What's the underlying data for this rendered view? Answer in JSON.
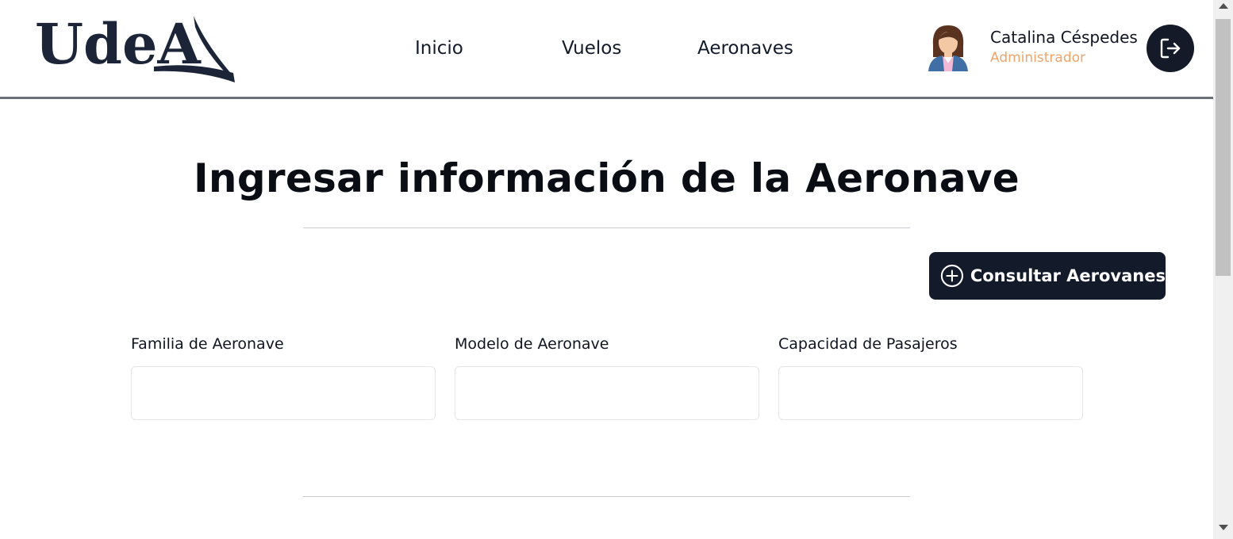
{
  "header": {
    "logo_text": "UdeA",
    "nav": [
      {
        "label": "Inicio"
      },
      {
        "label": "Vuelos"
      },
      {
        "label": "Aeronaves"
      }
    ],
    "user": {
      "name": "Catalina Céspedes",
      "role": "Administrador"
    },
    "logout_icon": "logout-icon"
  },
  "main": {
    "title": "Ingresar información de la Aeronave",
    "consult_button": {
      "label": "Consultar Aerovanes",
      "icon": "plus-circle-icon"
    },
    "fields": [
      {
        "label": "Familia de Aeronave",
        "value": ""
      },
      {
        "label": "Modelo de Aeronave",
        "value": ""
      },
      {
        "label": "Capacidad de Pasajeros",
        "value": ""
      }
    ]
  },
  "colors": {
    "primary": "#131a2a",
    "role_accent": "#f0a46a",
    "header_border": "#6b7078"
  }
}
